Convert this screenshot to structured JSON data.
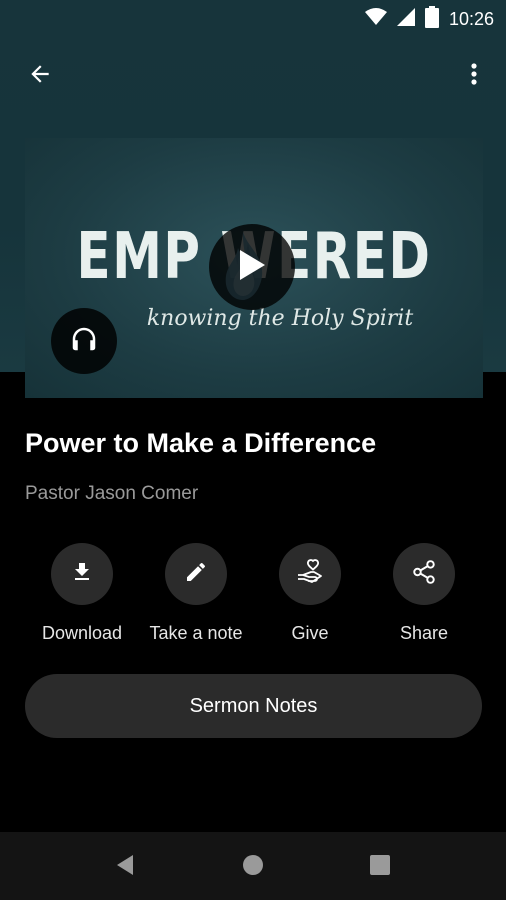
{
  "status_bar": {
    "time": "10:26",
    "icons": [
      "wifi-icon",
      "cellular-signal-icon",
      "battery-icon"
    ]
  },
  "app_bar": {
    "back_icon": "arrow-back-icon",
    "menu_icon": "more-vert-icon"
  },
  "hero": {
    "series_title": "EMP  WERED",
    "series_subtitle": "knowing the Holy Spirit",
    "play_icon": "play-icon",
    "audio_icon": "headphones-icon"
  },
  "sermon": {
    "title": "Power to Make a Difference",
    "speaker": "Pastor Jason Comer"
  },
  "actions": [
    {
      "label": "Download",
      "icon": "download-icon"
    },
    {
      "label": "Take a note",
      "icon": "pencil-icon"
    },
    {
      "label": "Give",
      "icon": "give-hand-heart-icon"
    },
    {
      "label": "Share",
      "icon": "share-icon"
    }
  ],
  "notes_button": {
    "label": "Sermon Notes"
  },
  "nav_bar": {
    "icons": [
      "back-triangle-icon",
      "home-circle-icon",
      "recents-square-icon"
    ]
  },
  "colors": {
    "header_bg": "#17343b",
    "page_bg": "#000000",
    "button_bg": "#2b2b2b",
    "secondary_text": "#9a9a9a"
  }
}
